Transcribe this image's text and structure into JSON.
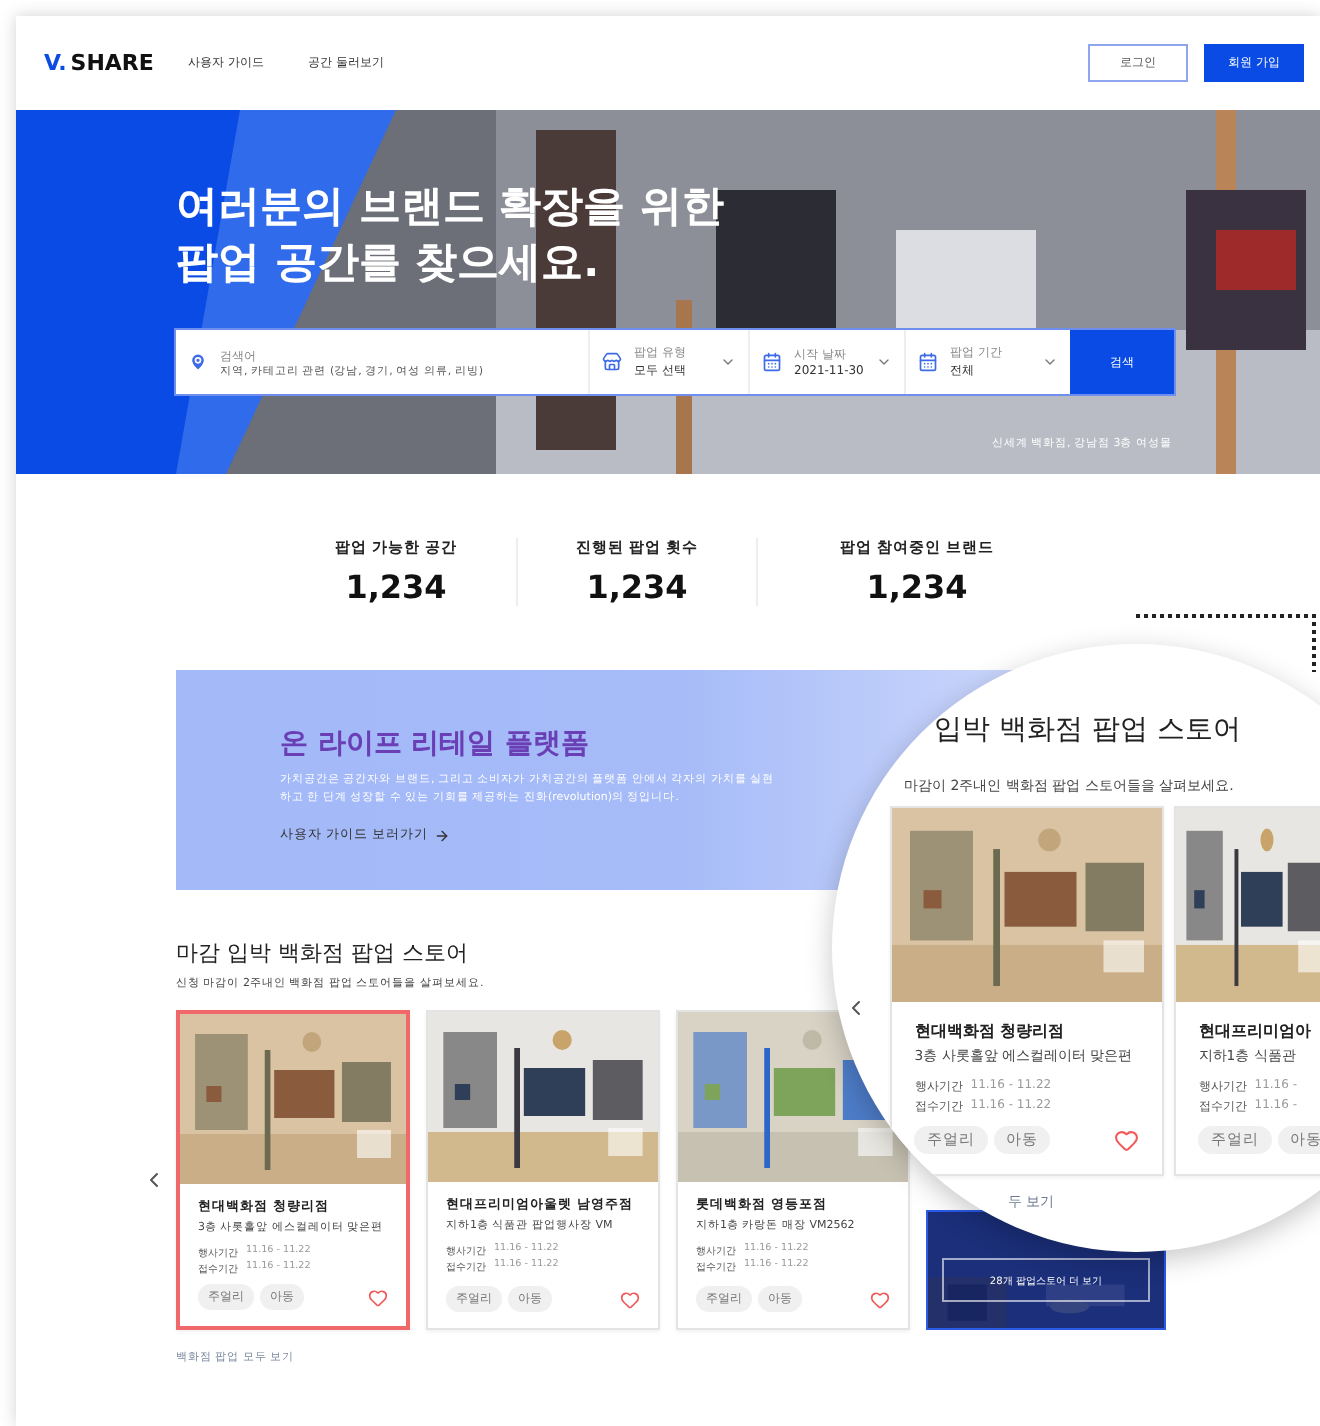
{
  "header": {
    "logo": {
      "mark": "V.",
      "text": "SHARE"
    },
    "nav": [
      "사용자 가이드",
      "공간 둘러보기"
    ],
    "login": "로그인",
    "signup": "회원 가입"
  },
  "hero": {
    "title": [
      "여러분의 브랜드 확장을 위한",
      "팝업 공간를 찾으세요."
    ],
    "search_fields": [
      {
        "kind": "text",
        "label": "검색어",
        "placeholder": "지역, 카테고리 관련 (강남, 경기, 여성 의류, 리빙)"
      },
      {
        "kind": "category",
        "label": "팝업 유형",
        "value": "모두 선택"
      },
      {
        "kind": "date",
        "label": "시작 날짜",
        "value": "2021-11-30"
      },
      {
        "kind": "date",
        "label": "팝업 기간",
        "value": "전체"
      }
    ],
    "search_button": "검색",
    "caption": "신세계 백화점, 강남점 3층 여성몰"
  },
  "stats": [
    {
      "label": "팝업 가능한 공간",
      "value": "1,234"
    },
    {
      "label": "진행된 팝업 횟수",
      "value": "1,234"
    },
    {
      "label": "팝업 참여중인 브랜드",
      "value": "1,234"
    }
  ],
  "banner": {
    "title": "온 라이프 리테일 플랫폼",
    "text": "가치공간은 공간자와 브랜드, 그리고 소비자가 가치공간의 플랫폼 안에서 각자의 가치를 실현하고 한 단계 성장할 수 있는 기회를 제공하는 진화(revolution)의 정입니다.",
    "link": "사용자 가이드 보러가기"
  },
  "section": {
    "title": "마감 입박 백화점 팝업 스토어",
    "subtitle": "신청 마감이 2주내인 백화점 팝업 스토어들을 살펴보세요.",
    "cards": [
      {
        "kind": "store",
        "selected": true,
        "name": "현대백화점 청량리점",
        "address": "3층 사롯홀앞 에스컬레이터 맞은편",
        "dates": [
          {
            "label": "행사기간",
            "value": "11.16 - 11.22"
          },
          {
            "label": "접수기간",
            "value": "11.16 - 11.22"
          }
        ],
        "tags": [
          "주얼리",
          "아동"
        ]
      },
      {
        "kind": "store",
        "selected": false,
        "name": "현대프리미엄아울렛 남영주점",
        "address": "지하1층 식품관 팝업행사장 VM",
        "dates": [
          {
            "label": "행사기간",
            "value": "11.16 - 11.22"
          },
          {
            "label": "접수기간",
            "value": "11.16 - 11.22"
          }
        ],
        "tags": [
          "주얼리",
          "아동"
        ]
      },
      {
        "kind": "store",
        "selected": false,
        "name": "롯데백화점 영등포점",
        "address": "지하1층 카랑돈 매장 VM2562",
        "dates": [
          {
            "label": "행사기간",
            "value": "11.16 - 11.22"
          },
          {
            "label": "접수기간",
            "value": "11.16 - 11.22"
          }
        ],
        "tags": [
          "주얼리",
          "아동"
        ]
      },
      {
        "kind": "promo",
        "button": "28개 팝업스토어 더 보기"
      }
    ],
    "link": "백화점 팝업 모두 보기"
  },
  "magnifier": {
    "title": "입박 백화점 팝업 스토어",
    "subtitle": "마감이 2주내인 백화점 팝업 스토어들을 살펴보세요.",
    "cards": [
      {
        "name": "현대백화점 청량리점",
        "address": "3층 사롯홀앞 에스컬레이터 맞은편",
        "dates": [
          {
            "label": "행사기간",
            "value": "11.16 - 11.22"
          },
          {
            "label": "접수기간",
            "value": "11.16 - 11.22"
          }
        ],
        "tags": [
          "주얼리",
          "아동"
        ]
      },
      {
        "name": "현대프리미엄아",
        "address": "지하1층 식품관",
        "dates": [
          {
            "label": "행사기간",
            "value": "11.16 -"
          },
          {
            "label": "접수기간",
            "value": "11.16 -"
          }
        ],
        "tags": [
          "주얼리",
          "아동"
        ]
      }
    ],
    "link": "두 보기"
  }
}
